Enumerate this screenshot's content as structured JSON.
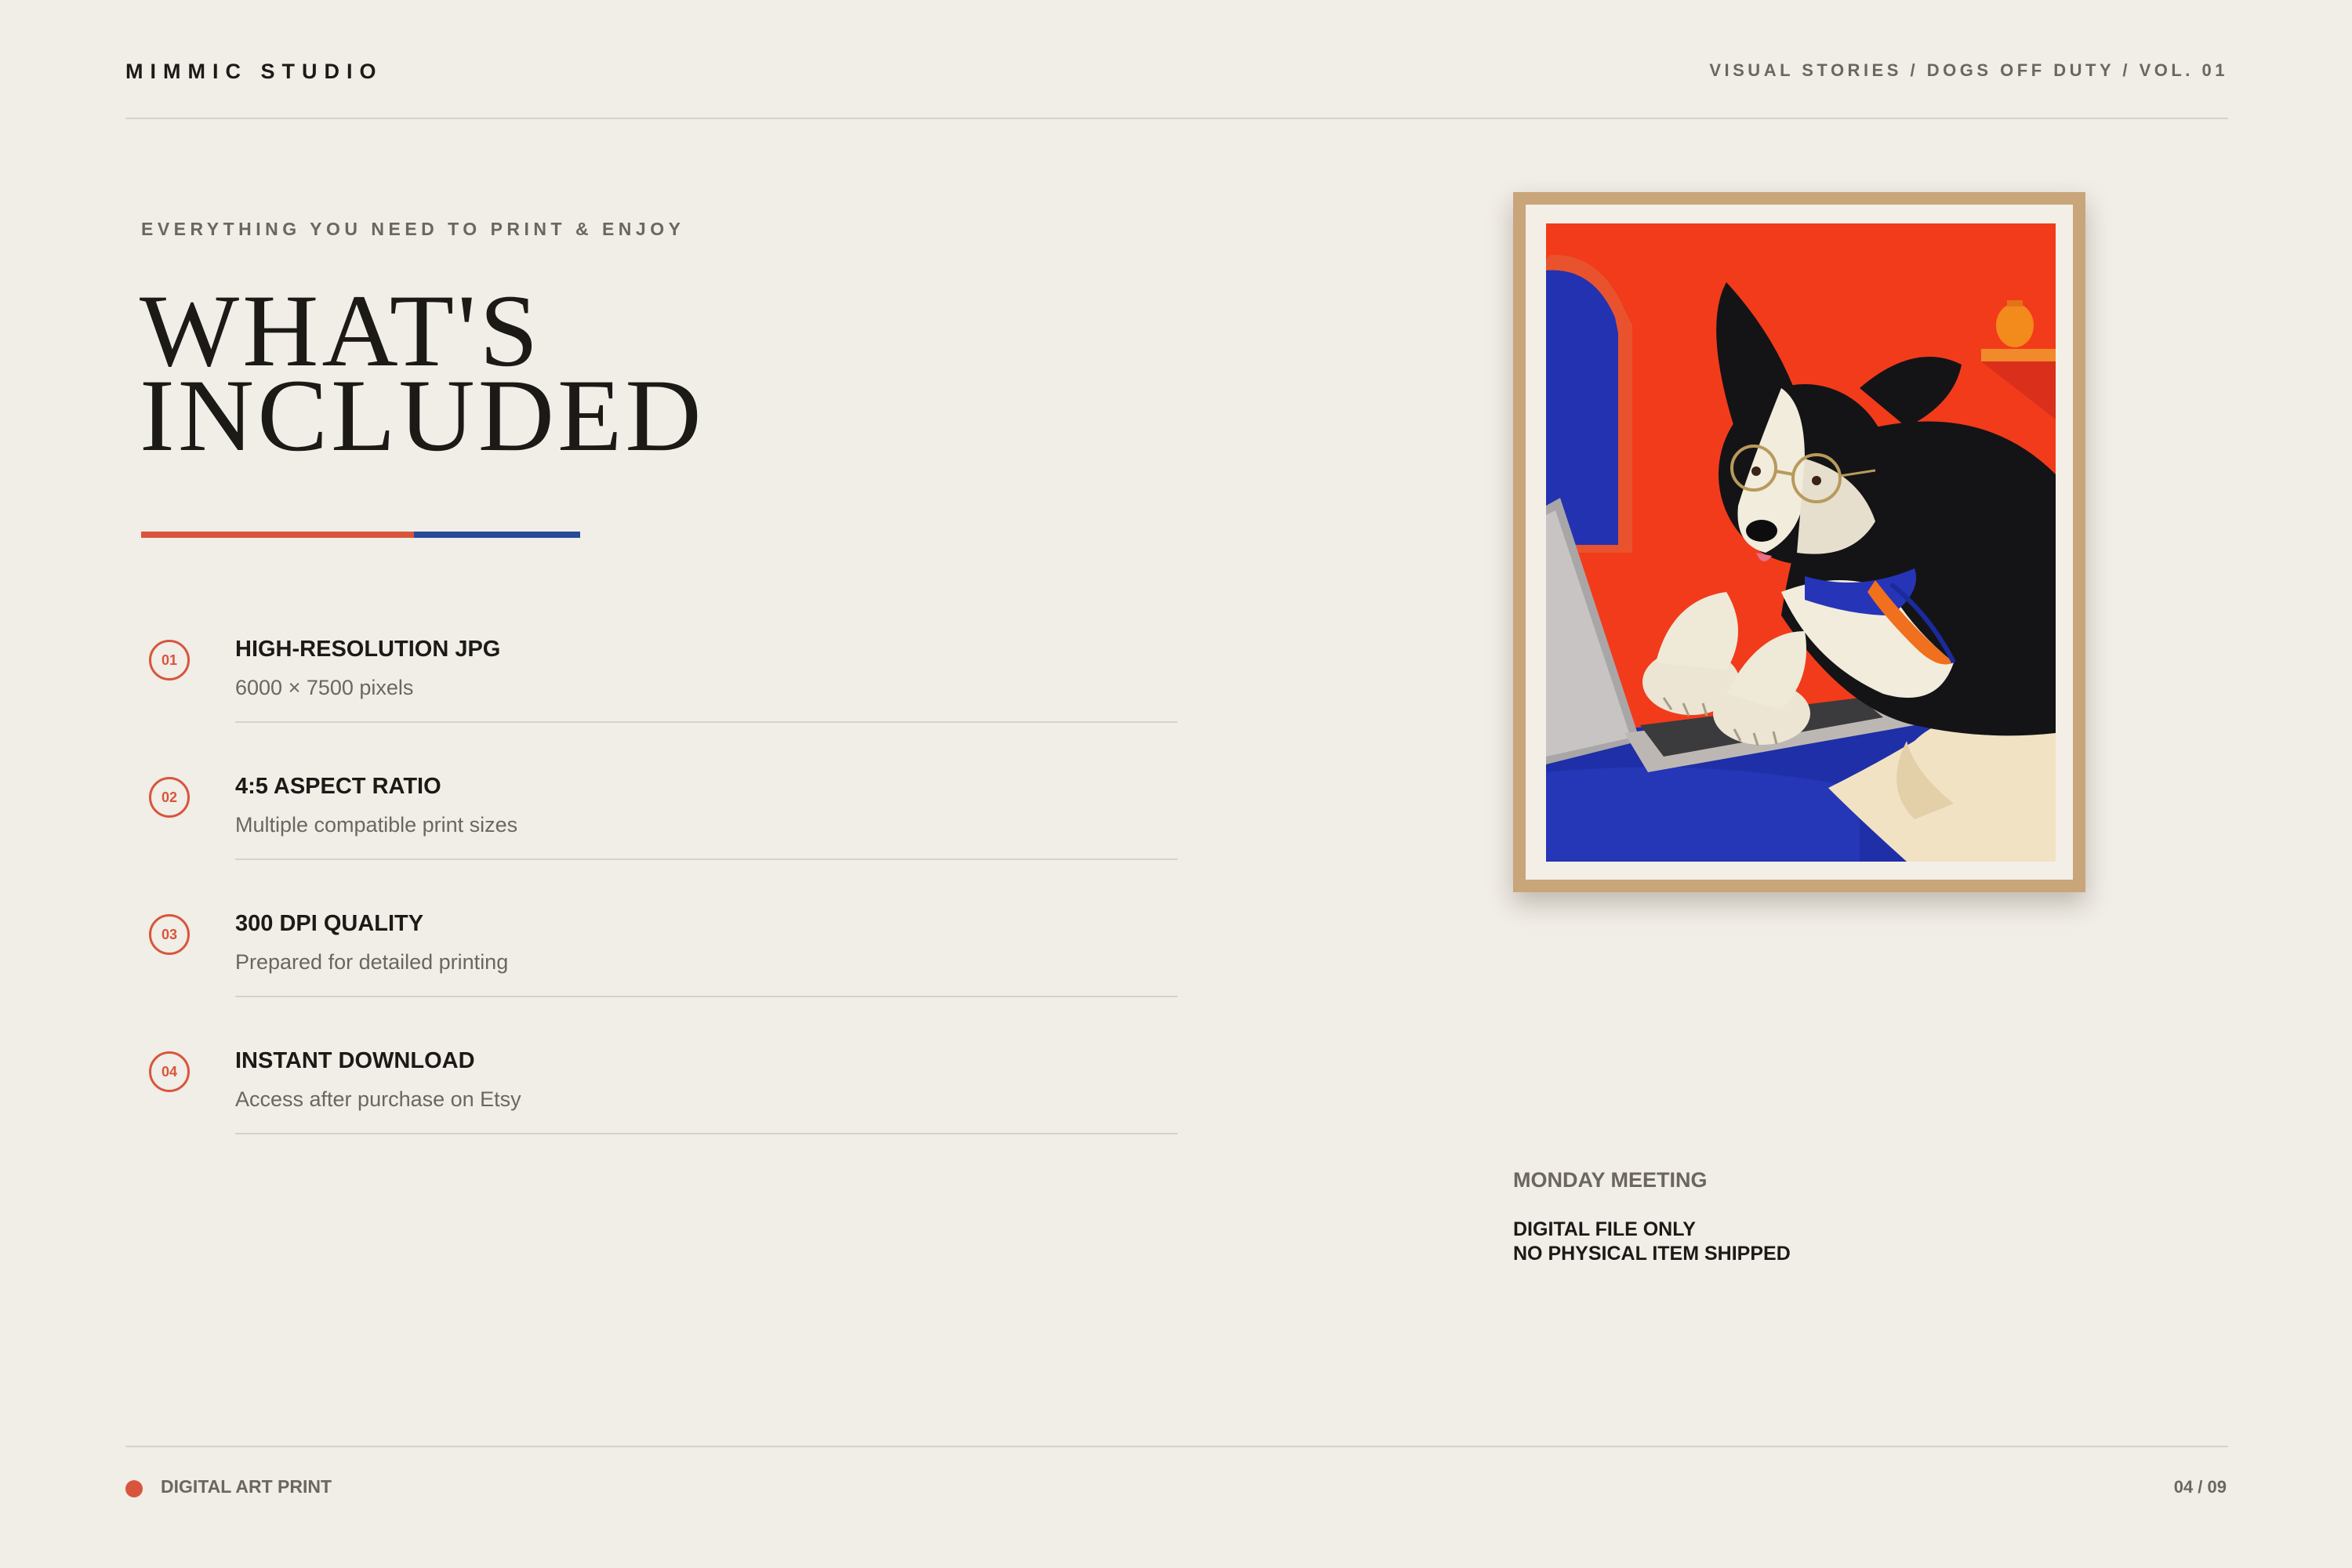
{
  "header": {
    "brand": "MIMMIC STUDIO",
    "breadcrumb": "VISUAL STORIES / DOGS OFF DUTY / VOL. 01"
  },
  "hero": {
    "eyebrow": "EVERYTHING YOU NEED TO PRINT & ENJOY",
    "headline_line1": "WHAT'S",
    "headline_line2": "INCLUDED"
  },
  "features": [
    {
      "number": "01",
      "title": "HIGH-RESOLUTION JPG",
      "subtitle": "6000 × 7500 pixels"
    },
    {
      "number": "02",
      "title": "4:5 ASPECT RATIO",
      "subtitle": "Multiple compatible print sizes"
    },
    {
      "number": "03",
      "title": "300 DPI QUALITY",
      "subtitle": "Prepared for detailed printing"
    },
    {
      "number": "04",
      "title": "INSTANT DOWNLOAD",
      "subtitle": "Access after purchase on Etsy"
    }
  ],
  "artwork": {
    "title": "MONDAY MEETING",
    "note_line1": "DIGITAL FILE ONLY",
    "note_line2": "NO PHYSICAL ITEM SHIPPED"
  },
  "footer": {
    "label": "DIGITAL ART PRINT",
    "page": "04 / 09"
  },
  "colors": {
    "background": "#f1ede7",
    "accent_red": "#d8553c",
    "accent_blue": "#2a4a9a",
    "frame": "#c9a57a"
  },
  "icons": {
    "footer_dot": "dot-icon"
  }
}
